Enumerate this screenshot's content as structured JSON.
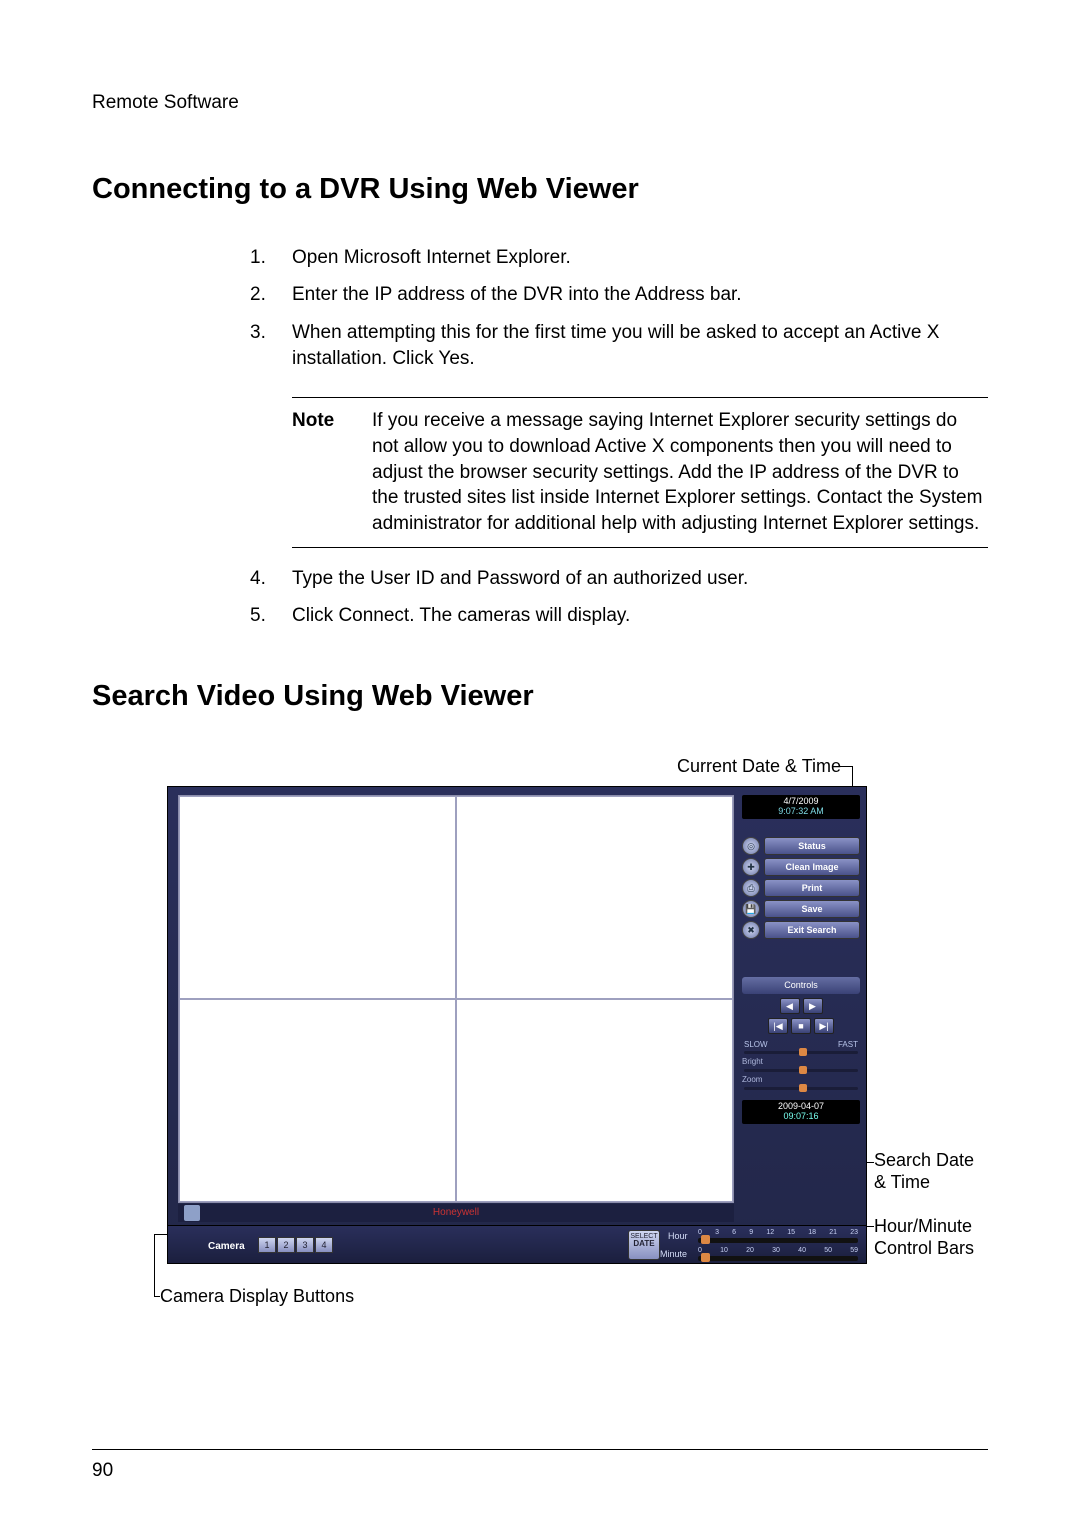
{
  "header": {
    "running": "Remote Software"
  },
  "section1": {
    "title": "Connecting to a DVR Using Web Viewer",
    "steps": [
      "Open Microsoft Internet Explorer.",
      "Enter the IP address of the DVR into the Address bar.",
      "When attempting this for the first time you will be asked to accept an Active X installation. Click Yes.",
      "Type the User ID and Password of an authorized user.",
      "Click Connect. The cameras will display."
    ],
    "note_label": "Note",
    "note_text": "If you receive a message saying Internet Explorer security settings do not allow you to download Active X components then you will need to adjust the browser security settings. Add the IP address of the DVR to the trusted sites list inside Internet Explorer settings. Contact the System administrator for additional help with adjusting Internet Explorer settings."
  },
  "section2": {
    "title": "Search Video Using Web Viewer"
  },
  "callouts": {
    "current_dt": "Current Date & Time",
    "search_dt": "Search Date & Time",
    "hm_bars": "Hour/Minute Control Bars",
    "cam_btns": "Camera Display Buttons"
  },
  "viewer": {
    "current_date": "4/7/2009",
    "current_time": "9:07:32 AM",
    "brand": "Honeywell",
    "buttons": {
      "status": "Status",
      "clean": "Clean Image",
      "print": "Print",
      "save": "Save",
      "exit": "Exit Search"
    },
    "controls_hdr": "Controls",
    "speed_slow": "SLOW",
    "speed_fast": "FAST",
    "bright_label": "Bright",
    "zoom_label": "Zoom",
    "search_date": "2009-04-07",
    "search_time": "09:07:16",
    "camera_label": "Camera",
    "cameras": [
      "1",
      "2",
      "3",
      "4"
    ],
    "select_date_top": "SELECT",
    "select_date_bottom": "DATE",
    "hour_label": "Hour",
    "minute_label": "Minute",
    "hour_marks": [
      "0",
      "3",
      "6",
      "9",
      "12",
      "15",
      "18",
      "21",
      "23"
    ],
    "minute_marks": [
      "0",
      "10",
      "20",
      "30",
      "40",
      "50",
      "59"
    ]
  },
  "page_number": "90"
}
